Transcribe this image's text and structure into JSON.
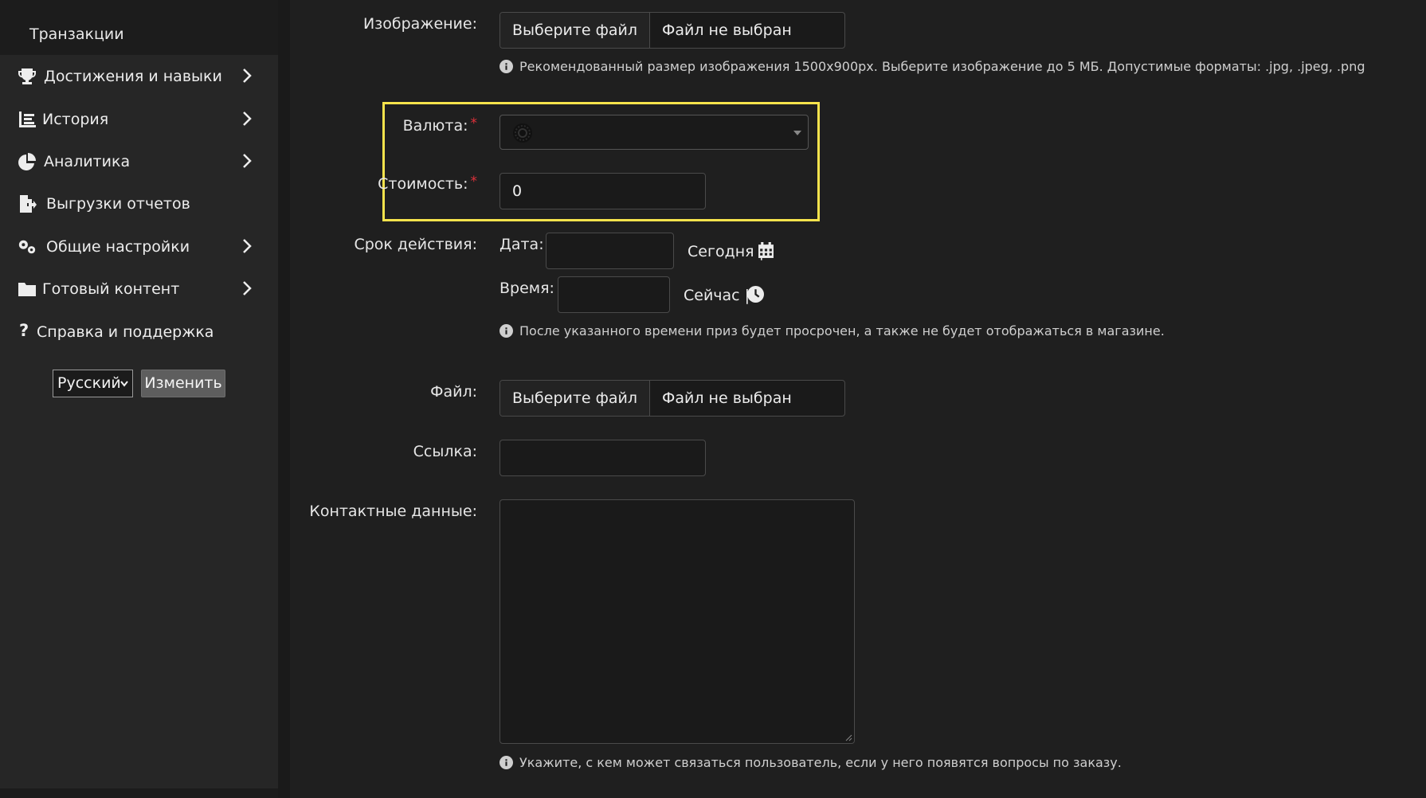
{
  "sidebar": {
    "top_label": "Транзакции",
    "items": [
      {
        "label": "Достижения и навыки",
        "icon": "trophy-icon",
        "has_submenu": true
      },
      {
        "label": "История",
        "icon": "list-chart-icon",
        "has_submenu": true
      },
      {
        "label": "Аналитика",
        "icon": "pie-chart-icon",
        "has_submenu": true
      },
      {
        "label": "Выгрузки отчетов",
        "icon": "file-export-icon",
        "has_submenu": false
      },
      {
        "label": "Общие настройки",
        "icon": "cogs-icon",
        "has_submenu": true
      },
      {
        "label": "Готовый контент",
        "icon": "folder-icon",
        "has_submenu": true
      },
      {
        "label": "Справка и поддержка",
        "icon": "question-icon",
        "has_submenu": false
      }
    ],
    "language": {
      "selected": "Русский",
      "change_label": "Изменить"
    }
  },
  "form": {
    "image": {
      "label": "Изображение:",
      "button": "Выберите файл",
      "filename": "Файл не выбран",
      "hint": "Рекомендованный размер изображения 1500x900px. Выберите изображение до 5 МБ. Допустимые форматы: .jpg, .jpeg, .png"
    },
    "currency": {
      "label": "Валюта:",
      "required": "*",
      "icon": "coin-icon"
    },
    "price": {
      "label": "Стоимость:",
      "required": "*",
      "value": "0"
    },
    "validity": {
      "label": "Срок действия:",
      "date_label": "Дата:",
      "date_value": "",
      "today_link": "Сегодня |",
      "time_label": "Время:",
      "time_value": "",
      "now_link": "Сейчас |",
      "hint": "После указанного времени приз будет просрочен, а также не будет отображаться в магазине."
    },
    "file": {
      "label": "Файл:",
      "button": "Выберите файл",
      "filename": "Файл не выбран"
    },
    "link": {
      "label": "Ссылка:",
      "value": ""
    },
    "contacts": {
      "label": "Контактные данные:",
      "value": "",
      "hint": "Укажите, с кем может связаться пользователь, если у него появятся вопросы по заказу."
    }
  },
  "colors": {
    "highlight": "#f7e34c",
    "required": "#e0313b",
    "background": "#1f1f1f",
    "sidebar": "#262626"
  }
}
